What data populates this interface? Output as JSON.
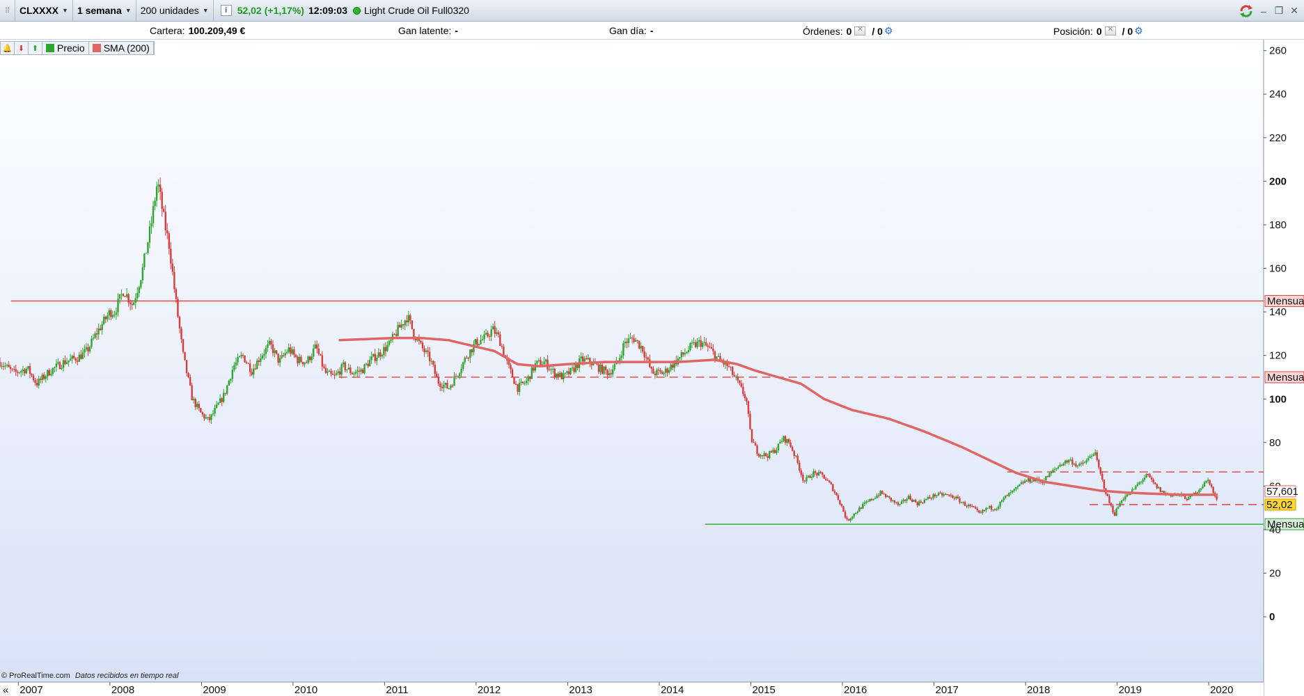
{
  "toolbar": {
    "symbol": "CLXXXX",
    "timeframe": "1 semana",
    "units": "200 unidades",
    "info_label": "i",
    "price": "52,02",
    "change": "(+1,17%)",
    "time": "12:09:03",
    "instrument": "Light Crude Oil Full0320",
    "window_buttons": [
      "–",
      "❐",
      "✕"
    ]
  },
  "account": {
    "cartera_label": "Cartera:",
    "cartera_value": "100.209,49 €",
    "gan_latente_label": "Gan latente:",
    "gan_latente_value": "-",
    "gan_dia_label": "Gan día:",
    "gan_dia_value": "-",
    "ordenes_label": "Órdenes:",
    "ordenes_value_1": "0",
    "ordenes_value_2": "/ 0",
    "posicion_label": "Posición:",
    "posicion_value_1": "0",
    "posicion_value_2": "/ 0"
  },
  "legend": {
    "items": [
      {
        "label": "Precio",
        "color": "#2fa52f"
      },
      {
        "label": "SMA (200)",
        "color": "#e06666"
      }
    ]
  },
  "footer": {
    "brand": "© ProRealTime.com",
    "note": "Datos recibidos en tiempo real"
  },
  "chart_data": {
    "type": "candlestick",
    "x_ticks": [
      "2007",
      "2008",
      "2009",
      "2010",
      "2011",
      "2012",
      "2013",
      "2014",
      "2015",
      "2016",
      "2017",
      "2018",
      "2019",
      "2020"
    ],
    "y_ticks": [
      0,
      20,
      40,
      60,
      80,
      100,
      120,
      140,
      160,
      180,
      200,
      220,
      240,
      260
    ],
    "y_bold_ticks": [
      0,
      100,
      200
    ],
    "ylim": [
      -30,
      265
    ],
    "xlim": [
      2006.8,
      2020.6
    ],
    "colors": {
      "up": "#2fa52f",
      "down": "#d93a3a",
      "sma": "#e06666",
      "support": "#2fa52f",
      "resistance": "#e04040"
    },
    "price_series": [
      [
        2006.8,
        117
      ],
      [
        2006.95,
        112
      ],
      [
        2007.1,
        114
      ],
      [
        2007.2,
        107
      ],
      [
        2007.35,
        113
      ],
      [
        2007.5,
        117
      ],
      [
        2007.65,
        119
      ],
      [
        2007.75,
        122
      ],
      [
        2007.85,
        130
      ],
      [
        2008.0,
        140
      ],
      [
        2008.05,
        140
      ],
      [
        2008.15,
        150
      ],
      [
        2008.25,
        143
      ],
      [
        2008.35,
        158
      ],
      [
        2008.45,
        180
      ],
      [
        2008.52,
        200
      ],
      [
        2008.6,
        180
      ],
      [
        2008.65,
        170
      ],
      [
        2008.72,
        145
      ],
      [
        2008.8,
        120
      ],
      [
        2008.9,
        100
      ],
      [
        2009.0,
        93
      ],
      [
        2009.08,
        90
      ],
      [
        2009.15,
        95
      ],
      [
        2009.25,
        102
      ],
      [
        2009.35,
        115
      ],
      [
        2009.45,
        120
      ],
      [
        2009.55,
        113
      ],
      [
        2009.65,
        120
      ],
      [
        2009.75,
        125
      ],
      [
        2009.85,
        117
      ],
      [
        2009.95,
        123
      ],
      [
        2010.05,
        118
      ],
      [
        2010.15,
        117
      ],
      [
        2010.25,
        124
      ],
      [
        2010.35,
        112
      ],
      [
        2010.45,
        110
      ],
      [
        2010.55,
        115
      ],
      [
        2010.65,
        112
      ],
      [
        2010.75,
        113
      ],
      [
        2010.85,
        118
      ],
      [
        2010.95,
        121
      ],
      [
        2011.05,
        125
      ],
      [
        2011.15,
        132
      ],
      [
        2011.25,
        138
      ],
      [
        2011.32,
        130
      ],
      [
        2011.4,
        124
      ],
      [
        2011.5,
        118
      ],
      [
        2011.58,
        108
      ],
      [
        2011.7,
        105
      ],
      [
        2011.8,
        112
      ],
      [
        2011.9,
        120
      ],
      [
        2012.0,
        126
      ],
      [
        2012.1,
        128
      ],
      [
        2012.18,
        132
      ],
      [
        2012.25,
        128
      ],
      [
        2012.35,
        115
      ],
      [
        2012.45,
        105
      ],
      [
        2012.55,
        108
      ],
      [
        2012.65,
        116
      ],
      [
        2012.75,
        117
      ],
      [
        2012.85,
        112
      ],
      [
        2012.95,
        110
      ],
      [
        2013.05,
        113
      ],
      [
        2013.15,
        118
      ],
      [
        2013.25,
        117
      ],
      [
        2013.35,
        114
      ],
      [
        2013.45,
        112
      ],
      [
        2013.55,
        117
      ],
      [
        2013.62,
        126
      ],
      [
        2013.72,
        128
      ],
      [
        2013.82,
        123
      ],
      [
        2013.92,
        112
      ],
      [
        2014.05,
        112
      ],
      [
        2014.15,
        116
      ],
      [
        2014.25,
        120
      ],
      [
        2014.35,
        124
      ],
      [
        2014.45,
        126
      ],
      [
        2014.55,
        123
      ],
      [
        2014.65,
        118
      ],
      [
        2014.75,
        115
      ],
      [
        2014.85,
        108
      ],
      [
        2014.95,
        100
      ],
      [
        2015.0,
        82
      ],
      [
        2015.08,
        75
      ],
      [
        2015.18,
        74
      ],
      [
        2015.28,
        77
      ],
      [
        2015.35,
        82
      ],
      [
        2015.42,
        80
      ],
      [
        2015.5,
        72
      ],
      [
        2015.58,
        62
      ],
      [
        2015.68,
        66
      ],
      [
        2015.78,
        65
      ],
      [
        2015.88,
        60
      ],
      [
        2015.98,
        52
      ],
      [
        2016.05,
        44
      ],
      [
        2016.12,
        47
      ],
      [
        2016.22,
        51
      ],
      [
        2016.32,
        54
      ],
      [
        2016.42,
        57
      ],
      [
        2016.52,
        54
      ],
      [
        2016.62,
        51
      ],
      [
        2016.72,
        55
      ],
      [
        2016.82,
        52
      ],
      [
        2016.92,
        54
      ],
      [
        2017.02,
        56
      ],
      [
        2017.12,
        56
      ],
      [
        2017.22,
        55
      ],
      [
        2017.32,
        52
      ],
      [
        2017.42,
        50
      ],
      [
        2017.5,
        47
      ],
      [
        2017.58,
        50
      ],
      [
        2017.68,
        50
      ],
      [
        2017.78,
        55
      ],
      [
        2017.88,
        58
      ],
      [
        2017.98,
        62
      ],
      [
        2018.08,
        63
      ],
      [
        2018.18,
        62
      ],
      [
        2018.28,
        66
      ],
      [
        2018.38,
        70
      ],
      [
        2018.48,
        72
      ],
      [
        2018.58,
        69
      ],
      [
        2018.68,
        72
      ],
      [
        2018.75,
        76
      ],
      [
        2018.82,
        65
      ],
      [
        2018.9,
        54
      ],
      [
        2018.97,
        47
      ],
      [
        2019.05,
        54
      ],
      [
        2019.15,
        57
      ],
      [
        2019.25,
        62
      ],
      [
        2019.33,
        65
      ],
      [
        2019.42,
        60
      ],
      [
        2019.5,
        57
      ],
      [
        2019.58,
        56
      ],
      [
        2019.68,
        56
      ],
      [
        2019.78,
        54
      ],
      [
        2019.88,
        58
      ],
      [
        2019.95,
        61
      ],
      [
        2020.0,
        63
      ],
      [
        2020.05,
        57
      ],
      [
        2020.1,
        52
      ]
    ],
    "sma_series": [
      [
        2010.5,
        127
      ],
      [
        2010.8,
        127.5
      ],
      [
        2011.1,
        128
      ],
      [
        2011.4,
        128
      ],
      [
        2011.7,
        127
      ],
      [
        2012.0,
        124
      ],
      [
        2012.2,
        122
      ],
      [
        2012.45,
        116
      ],
      [
        2012.7,
        115
      ],
      [
        2013.0,
        116
      ],
      [
        2013.4,
        117
      ],
      [
        2013.8,
        117
      ],
      [
        2014.2,
        117
      ],
      [
        2014.6,
        118
      ],
      [
        2014.85,
        116
      ],
      [
        2015.05,
        113
      ],
      [
        2015.3,
        110
      ],
      [
        2015.55,
        107
      ],
      [
        2015.8,
        100
      ],
      [
        2016.1,
        95
      ],
      [
        2016.5,
        91
      ],
      [
        2016.9,
        85
      ],
      [
        2017.3,
        78
      ],
      [
        2017.65,
        71
      ],
      [
        2017.9,
        66
      ],
      [
        2018.2,
        62
      ],
      [
        2018.5,
        60
      ],
      [
        2018.8,
        58
      ],
      [
        2019.1,
        57
      ],
      [
        2019.4,
        56.5
      ],
      [
        2019.7,
        56
      ],
      [
        2020.0,
        56
      ],
      [
        2020.1,
        56
      ]
    ],
    "h_lines": [
      {
        "value": 145,
        "style": "solid",
        "color": "#e04040",
        "from": 2006.92,
        "label": "Mensual"
      },
      {
        "value": 110,
        "style": "dashed",
        "color": "#e04040",
        "from": 2010.5,
        "label": "Mensual"
      },
      {
        "value": 66.5,
        "style": "dashed",
        "color": "#e04040",
        "from": 2017.8,
        "label": ""
      },
      {
        "value": 51.5,
        "style": "dashed",
        "color": "#e04040",
        "from": 2018.7,
        "label": ""
      },
      {
        "value": 42.5,
        "style": "solid",
        "color": "#2fa52f",
        "from": 2014.5,
        "label": "Mensual"
      }
    ],
    "price_tags": [
      {
        "value": "57,601",
        "y": 57.6,
        "color": "#e06666",
        "bg": "#ffffff",
        "border": "#e06666"
      },
      {
        "value": "52,02",
        "y": 51.5,
        "color": "#000000",
        "bg": "#ffd633",
        "border": "#c9a300"
      }
    ]
  }
}
